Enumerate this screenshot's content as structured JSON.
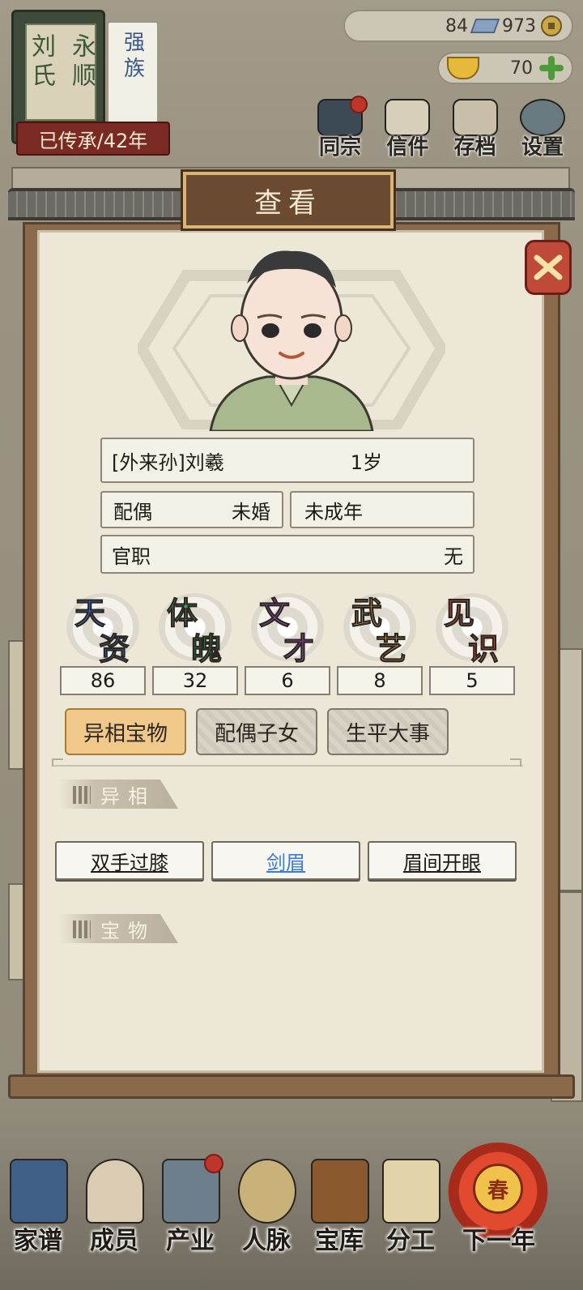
{
  "lineage": {
    "family_line1": "永顺",
    "family_line2": "刘氏",
    "clan_type": "强族",
    "generation": "已传承/42年"
  },
  "currency": {
    "silver": "84",
    "coins": "973",
    "gold": "70"
  },
  "top_menu": [
    {
      "label": "同宗",
      "icon": "clan-book-icon",
      "has_badge": true
    },
    {
      "label": "信件",
      "icon": "letter-icon",
      "has_badge": false
    },
    {
      "label": "存档",
      "icon": "scroll-save-icon",
      "has_badge": false
    },
    {
      "label": "设置",
      "icon": "gear-icon",
      "has_badge": false
    }
  ],
  "dialog": {
    "title": "查看",
    "close_icon": "close-icon"
  },
  "person": {
    "name": "[外来孙]刘羲",
    "age": "1岁",
    "spouse_label": "配偶",
    "spouse_value": "未婚",
    "adult_status": "未成年",
    "office_label": "官职",
    "office_value": "无"
  },
  "stats": [
    {
      "char1": "天",
      "char2": "资",
      "value": "86",
      "color": "#3d74d6"
    },
    {
      "char1": "体",
      "char2": "魄",
      "value": "32",
      "color": "#3aa56a"
    },
    {
      "char1": "文",
      "char2": "才",
      "value": "6",
      "color": "#a04ec8"
    },
    {
      "char1": "武",
      "char2": "艺",
      "value": "8",
      "color": "#e2a24a"
    },
    {
      "char1": "见",
      "char2": "识",
      "value": "5",
      "color": "#d8564a"
    }
  ],
  "tabs": [
    {
      "label": "异相宝物",
      "active": true
    },
    {
      "label": "配偶子女",
      "active": false
    },
    {
      "label": "生平大事",
      "active": false
    }
  ],
  "sections": {
    "traits_title": "异相",
    "treasures_title": "宝物"
  },
  "traits": [
    {
      "label": "双手过膝",
      "color": "#1e1b17"
    },
    {
      "label": "剑眉",
      "color": "#3a7bd5"
    },
    {
      "label": "眉间开眼",
      "color": "#1e1b17"
    }
  ],
  "bottom_nav": [
    {
      "label": "家谱",
      "icon": "family-tree-icon"
    },
    {
      "label": "成员",
      "icon": "member-icon"
    },
    {
      "label": "产业",
      "icon": "property-icon"
    },
    {
      "label": "人脉",
      "icon": "network-icon"
    },
    {
      "label": "宝库",
      "icon": "treasury-icon"
    },
    {
      "label": "分工",
      "icon": "assignment-icon"
    },
    {
      "label": "下一年",
      "icon": "next-year-icon",
      "badge": "春"
    }
  ]
}
